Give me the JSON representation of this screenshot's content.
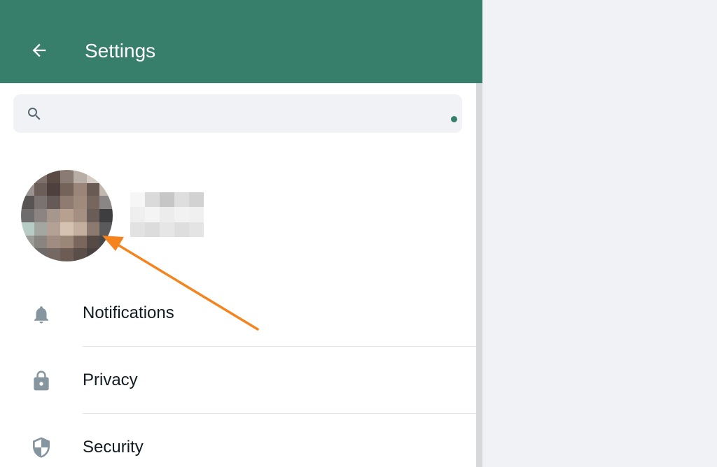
{
  "header": {
    "title": "Settings",
    "back_icon": "arrow-left-icon",
    "color": "#377f6b"
  },
  "search": {
    "placeholder": "",
    "icon": "search-icon"
  },
  "profile": {
    "avatar": "blurred-profile-photo",
    "name": ""
  },
  "annotation": {
    "type": "arrow",
    "color": "#f5841f",
    "points_to": "avatar"
  },
  "menu": {
    "items": [
      {
        "label": "Notifications",
        "icon": "bell-icon"
      },
      {
        "label": "Privacy",
        "icon": "lock-icon"
      },
      {
        "label": "Security",
        "icon": "shield-icon"
      }
    ]
  }
}
